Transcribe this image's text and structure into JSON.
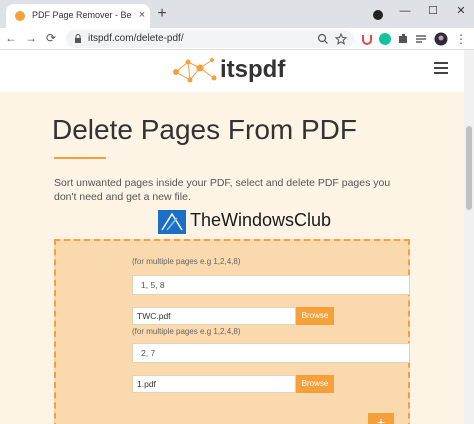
{
  "browser": {
    "tab_title": "PDF Page Remover - Best Online",
    "tab_close": "×",
    "new_tab": "+",
    "back": "←",
    "forward": "→",
    "reload": "⟳",
    "url": "itspdf.com/delete-pdf/",
    "minimize": "—",
    "maximize": "☐",
    "close": "✕",
    "menu": "⋮",
    "tab_dropdown": "⌄"
  },
  "site": {
    "logo_text": "itspdf"
  },
  "hero": {
    "title": "Delete Pages From PDF",
    "description": "Sort unwanted pages inside your PDF, select and delete PDF pages you don't need and get a new file."
  },
  "watermark": {
    "text": "TheWindowsClub"
  },
  "form": {
    "entries": [
      {
        "hint": "(for multiple pages e.g 1,2,4,8)",
        "pages": "1, 5, 8",
        "file": "TWC.pdf",
        "browse": "Browse"
      },
      {
        "hint": "(for multiple pages e.g 1,2,4,8)",
        "pages": "2, 7",
        "file": "1.pdf",
        "browse": "Browse"
      }
    ],
    "add_label": "+"
  },
  "colors": {
    "accent": "#f5a03b",
    "hero_bg": "#fdf4e5",
    "box_bg": "#fbd9ae"
  }
}
